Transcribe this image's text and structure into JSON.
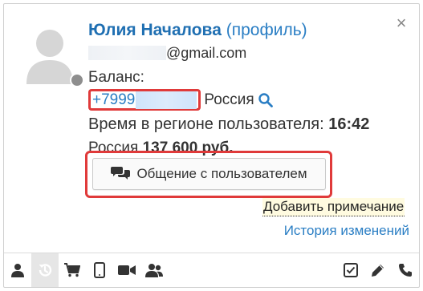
{
  "user": {
    "name": "Юлия Началова",
    "profile_link": "(профиль)",
    "email_suffix": "@gmail.com"
  },
  "balance_label": "Баланс:",
  "phone": {
    "prefix": "+7999",
    "country": "Россия"
  },
  "region_time": {
    "label": "Время в регионе пользователя: ",
    "value": "16:42"
  },
  "region_balance": {
    "country": "Россия ",
    "amount": "137 600 руб."
  },
  "chat_button_label": "Общение с пользователем",
  "add_note_label": "Добавить примечание",
  "history_label": "История изменений",
  "close_glyph": "×",
  "colors": {
    "link": "#2a7ec4",
    "highlight_border": "#e03a3a",
    "status_dot": "#8e8e8e"
  },
  "toolbar": {
    "icons_left": [
      "user-icon",
      "history-icon",
      "cart-icon",
      "tablet-icon",
      "video-icon",
      "users-icon"
    ],
    "icons_right": [
      "checkbox-icon",
      "pencil-icon",
      "phone-icon"
    ],
    "active": "history-icon"
  }
}
